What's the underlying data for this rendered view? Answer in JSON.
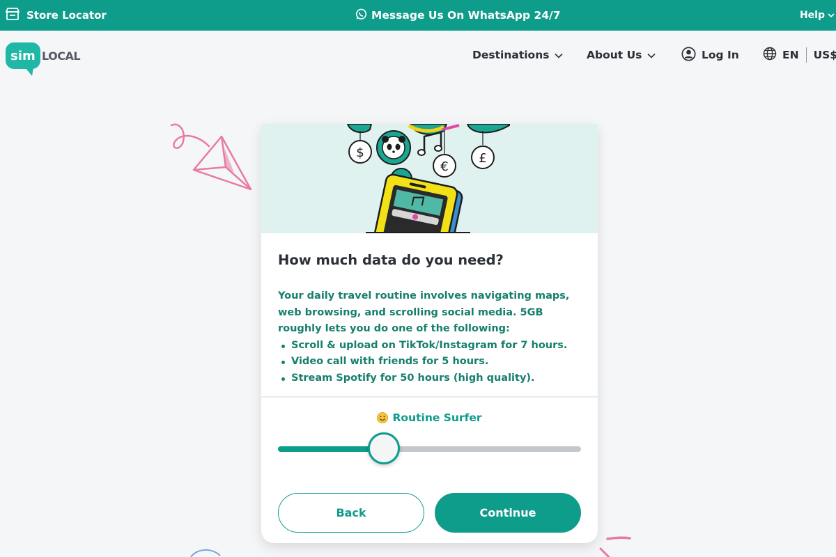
{
  "topbar": {
    "store_locator": "Store Locator",
    "whatsapp": "Message Us On WhatsApp 24/7",
    "help": "Help"
  },
  "logo": {
    "sim": "sim",
    "local": "LOCAL"
  },
  "nav": {
    "destinations": "Destinations",
    "about": "About Us",
    "login": "Log In",
    "language": "EN",
    "currency": "US$"
  },
  "card": {
    "title": "How much data do you need?",
    "intro": "Your daily travel routine involves navigating maps, web browsing, and scrolling social media. 5GB roughly lets you do one of the following:",
    "bullets": [
      "Scroll & upload on TikTok/Instagram for 7 hours.",
      "Video call with friends for 5 hours.",
      "Stream Spotify for 50 hours (high quality)."
    ],
    "level_label": "Routine Surfer",
    "slider_value": 0.35,
    "back_label": "Back",
    "continue_label": "Continue"
  },
  "colors": {
    "brand": "#0e9c8b",
    "logo": "#1fb8a6",
    "accent_pink": "#e87aa3",
    "text_dark": "#2b2f36"
  }
}
